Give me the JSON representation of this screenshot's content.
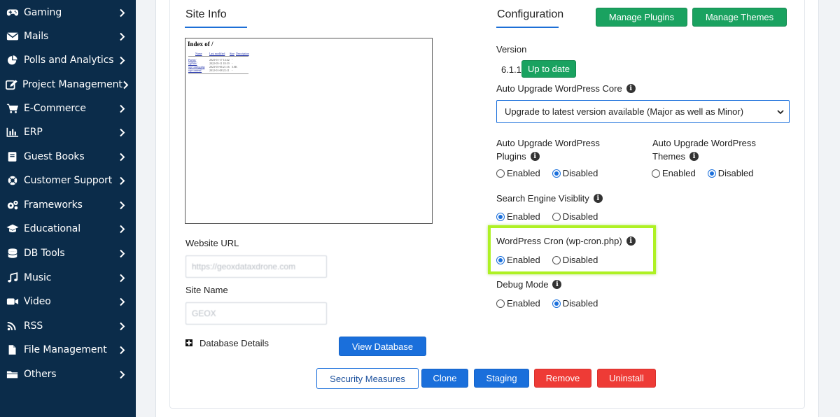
{
  "sidebar": {
    "items": [
      {
        "label": "Gaming",
        "icon": "gamepad-icon"
      },
      {
        "label": "Mails",
        "icon": "envelope-icon"
      },
      {
        "label": "Polls and Analytics",
        "icon": "pie-chart-icon"
      },
      {
        "label": "Project Management",
        "icon": "edit-icon"
      },
      {
        "label": "E-Commerce",
        "icon": "cart-icon"
      },
      {
        "label": "ERP",
        "icon": "bar-chart-icon"
      },
      {
        "label": "Guest Books",
        "icon": "book-icon"
      },
      {
        "label": "Customer Support",
        "icon": "lifebuoy-icon"
      },
      {
        "label": "Frameworks",
        "icon": "gears-icon"
      },
      {
        "label": "Educational",
        "icon": "graduation-cap-icon"
      },
      {
        "label": "DB Tools",
        "icon": "database-icon"
      },
      {
        "label": "Music",
        "icon": "music-icon"
      },
      {
        "label": "Video",
        "icon": "video-camera-icon"
      },
      {
        "label": "RSS",
        "icon": "rss-icon"
      },
      {
        "label": "File Management",
        "icon": "file-icon"
      },
      {
        "label": "Others",
        "icon": "folder-icon"
      }
    ]
  },
  "site_info": {
    "heading": "Site Info",
    "preview": {
      "title": "Index of /",
      "columns": [
        "Name",
        "Last modified",
        "Size",
        "Description"
      ],
      "rows": [
        {
          "name": "Parent/",
          "date": "2023-01-17 14:42",
          "size": "-"
        },
        {
          "name": "cgi-bin/",
          "date": "2022-05-11 18:19",
          "size": "-"
        },
        {
          "name": "wp-config.php",
          "date": "2023-03-06 21:16",
          "size": "3.0K"
        },
        {
          "name": "wp-content/",
          "date": "2012-01-08 22:11",
          "size": "-"
        }
      ]
    },
    "website_url_label": "Website URL",
    "website_url_value": "https://geoxdataxdrone.com",
    "site_name_label": "Site Name",
    "site_name_value": "GEOX",
    "database_details_label": "Database Details",
    "view_database_label": "View Database"
  },
  "configuration": {
    "heading": "Configuration",
    "manage_plugins_label": "Manage Plugins",
    "manage_themes_label": "Manage Themes",
    "version_label": "Version",
    "version_value": "6.1.1",
    "up_to_date_label": "Up to date",
    "auto_upgrade_core_label": "Auto Upgrade WordPress Core",
    "auto_upgrade_core_value": "Upgrade to latest version available (Major as well as Minor)",
    "auto_upgrade_plugins_label_1": "Auto Upgrade WordPress",
    "auto_upgrade_plugins_label_2": "Plugins",
    "auto_upgrade_themes_label_1": "Auto Upgrade WordPress",
    "auto_upgrade_themes_label_2": "Themes",
    "search_engine_label": "Search Engine Visiblity",
    "cron_label": "WordPress Cron (wp-cron.php)",
    "debug_label": "Debug Mode",
    "enabled_label": "Enabled",
    "disabled_label": "Disabled",
    "plugins_selected": "Disabled",
    "themes_selected": "Disabled",
    "search_engine_selected": "Enabled",
    "cron_selected": "Enabled",
    "debug_selected": "Disabled"
  },
  "actions": {
    "security_label": "Security Measures",
    "clone_label": "Clone",
    "staging_label": "Staging",
    "remove_label": "Remove",
    "uninstall_label": "Uninstall"
  },
  "colors": {
    "sidebar_bg": "#0b2c4a",
    "accent_blue": "#1a6fdb",
    "green": "#1aa260",
    "red": "#ee3b36",
    "highlight": "#aef123"
  }
}
